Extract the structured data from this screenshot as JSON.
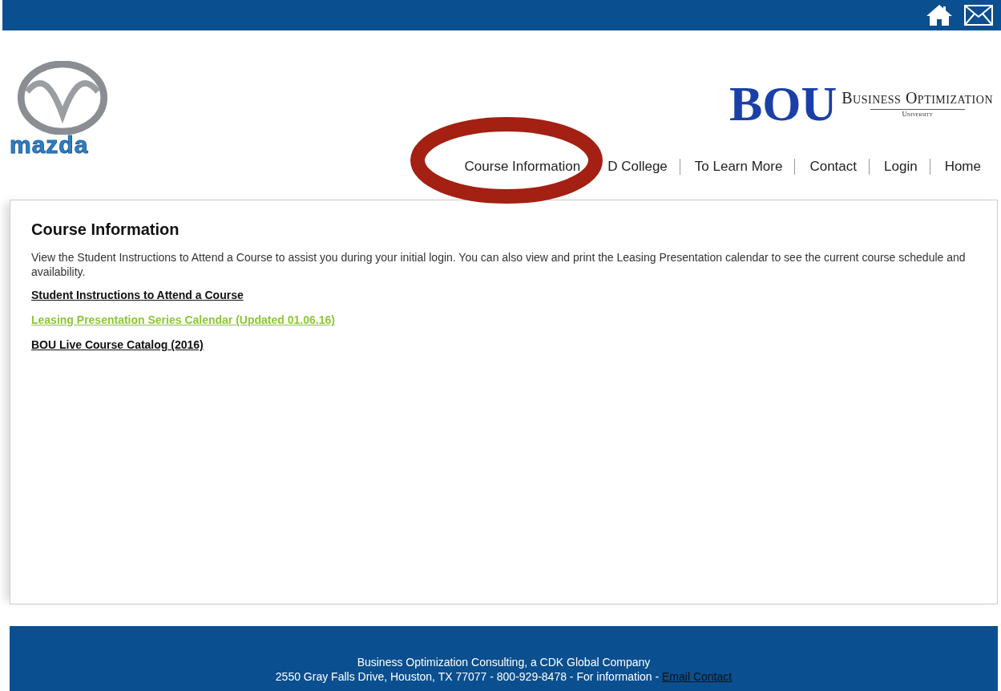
{
  "brand": {
    "mazda": "mazda",
    "bou": "BOU",
    "bou_name": "Business Optimization",
    "bou_sub": "University"
  },
  "nav": [
    {
      "label": "Course Information",
      "highlighted": true
    },
    {
      "label": "D College",
      "highlighted": false
    },
    {
      "label": "To Learn More",
      "highlighted": false
    },
    {
      "label": "Contact",
      "highlighted": false
    },
    {
      "label": "Login",
      "highlighted": false
    },
    {
      "label": "Home",
      "highlighted": false
    }
  ],
  "content": {
    "title": "Course Information",
    "intro": "View the Student Instructions to Attend a Course to assist you during your initial login.  You can also view and print the Leasing Presentation calendar to see the current course schedule and availability.",
    "links": [
      {
        "label": "Student Instructions to Attend a Course",
        "color": "#111111"
      },
      {
        "label": "Leasing Presentation Series Calendar (Updated 01.06.16)",
        "color": "#8cc63f"
      },
      {
        "label": "BOU Live Course Catalog (2016)",
        "color": "#111111"
      }
    ]
  },
  "footer": {
    "line1": "Business Optimization Consulting, a CDK Global Company",
    "line2": "2550 Gray Falls Drive, Houston, TX 77077 - 800-929-8478 - For information -",
    "link": "Email Contact"
  }
}
